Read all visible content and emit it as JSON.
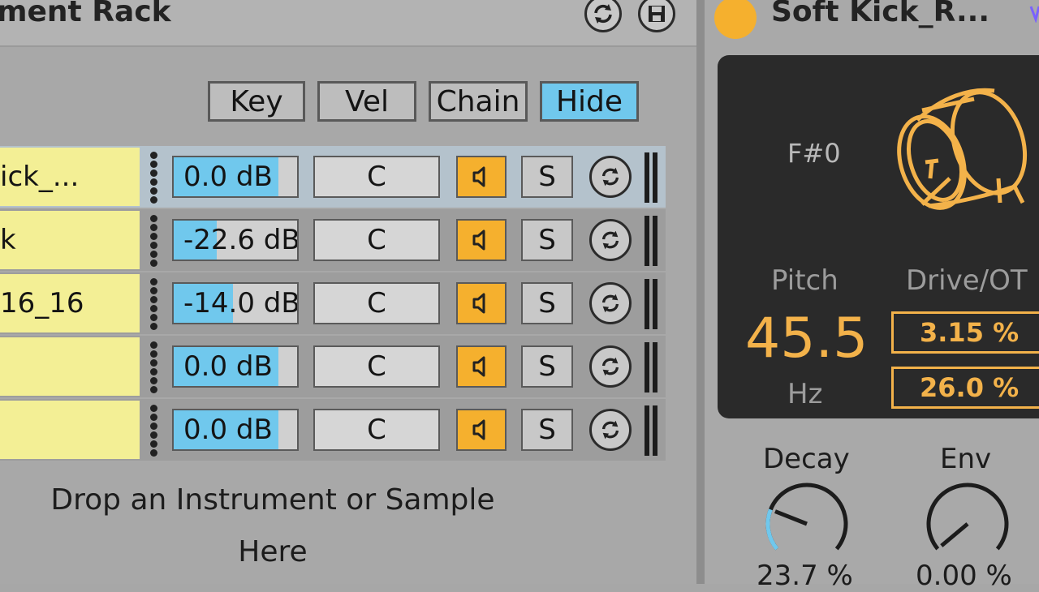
{
  "rack": {
    "title": "ment Rack",
    "header_buttons": [
      {
        "label": "Key",
        "active": false
      },
      {
        "label": "Vel",
        "active": false
      },
      {
        "label": "Chain",
        "active": false
      },
      {
        "label": "Hide",
        "active": true
      }
    ],
    "chains": [
      {
        "name": "ick_...",
        "volume": "0.0 dB",
        "volume_fill": 0.85,
        "pan": "C",
        "solo": "S",
        "selected": true
      },
      {
        "name": "k",
        "volume": "-22.6 dB",
        "volume_fill": 0.35,
        "pan": "C",
        "solo": "S",
        "selected": false
      },
      {
        "name": "16_16",
        "volume": "-14.0 dB",
        "volume_fill": 0.48,
        "pan": "C",
        "solo": "S",
        "selected": false
      },
      {
        "name": "",
        "volume": "0.0 dB",
        "volume_fill": 0.85,
        "pan": "C",
        "solo": "S",
        "selected": false
      },
      {
        "name": "",
        "volume": "0.0 dB",
        "volume_fill": 0.85,
        "pan": "C",
        "solo": "S",
        "selected": false
      }
    ],
    "drop_hint_line1": "Drop an Instrument or Sample",
    "drop_hint_line2": "Here"
  },
  "device": {
    "title": "Soft Kick_R...",
    "note": "F#0",
    "pitch_label": "Pitch",
    "pitch_value": "45.5",
    "pitch_unit": "Hz",
    "drive_label": "Drive/OT",
    "drive_value": "3.15 %",
    "ot_value": "26.0 %",
    "decay_label": "Decay",
    "decay_value": "23.7 %",
    "decay_level": 0.237,
    "env_label": "Env",
    "env_value": "0.00 %",
    "env_level": 0.0
  },
  "colors": {
    "accent_blue": "#70c8ed",
    "accent_orange": "#f5b02e",
    "chain_name_bg": "#f3ef95",
    "screen_bg": "#2a2a2a"
  }
}
